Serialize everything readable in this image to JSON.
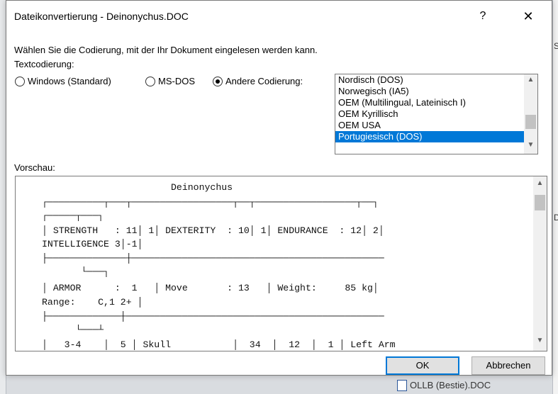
{
  "background": {
    "right_fragments": [
      "S",
      "D"
    ],
    "bottom_doc_label": "OLLB (Bestie).DOC"
  },
  "dialog": {
    "title": "Dateikonvertierung - Deinonychus.DOC",
    "help_glyph": "?",
    "close_glyph": "✕",
    "instruction": "Wählen Sie die Codierung, mit der Ihr Dokument eingelesen werden kann.",
    "encoding_label": "Textcodierung:",
    "radios": [
      {
        "label": "Windows (Standard)",
        "selected": false
      },
      {
        "label": "MS-DOS",
        "selected": false
      },
      {
        "label": "Andere Codierung:",
        "selected": true
      }
    ],
    "encoding_list": {
      "items": [
        "Nordisch (DOS)",
        "Norwegisch (IA5)",
        "OEM (Multilingual, Lateinisch I)",
        "OEM Kyrillisch",
        "OEM USA",
        "Portugiesisch (DOS)"
      ],
      "selected": "Portugiesisch (DOS)"
    },
    "preview_label": "Vorschau:",
    "preview_lines": [
      "                       Deinonychus",
      "┌──────────┬───┬──────────────────┬──┬──────────────────┬──┐",
      "┌─────┬───┐",
      "│ STRENGTH   : 11│ 1│ DEXTERITY  : 10│ 1│ ENDURANCE  : 12│ 2│",
      "INTELLIGENCE 3│-1│",
      "├──────────────┼─────────────────────────────────────────────",
      "       └───┐",
      "│ ARMOR      :  1   │ Move       : 13   │ Weight:     85 kg│",
      "Range:    C,1 2+ │",
      "├─────────────┼──────────────────────────────────────────────",
      "      └───┴",
      "│   3-4    │  5 │ Skull           │  34  │  12  │  1 │ Left Arm"
    ],
    "ok_label": "OK",
    "cancel_label": "Abbrechen"
  },
  "colors": {
    "selection": "#0078d7",
    "default_button_border": "#0078d7"
  }
}
